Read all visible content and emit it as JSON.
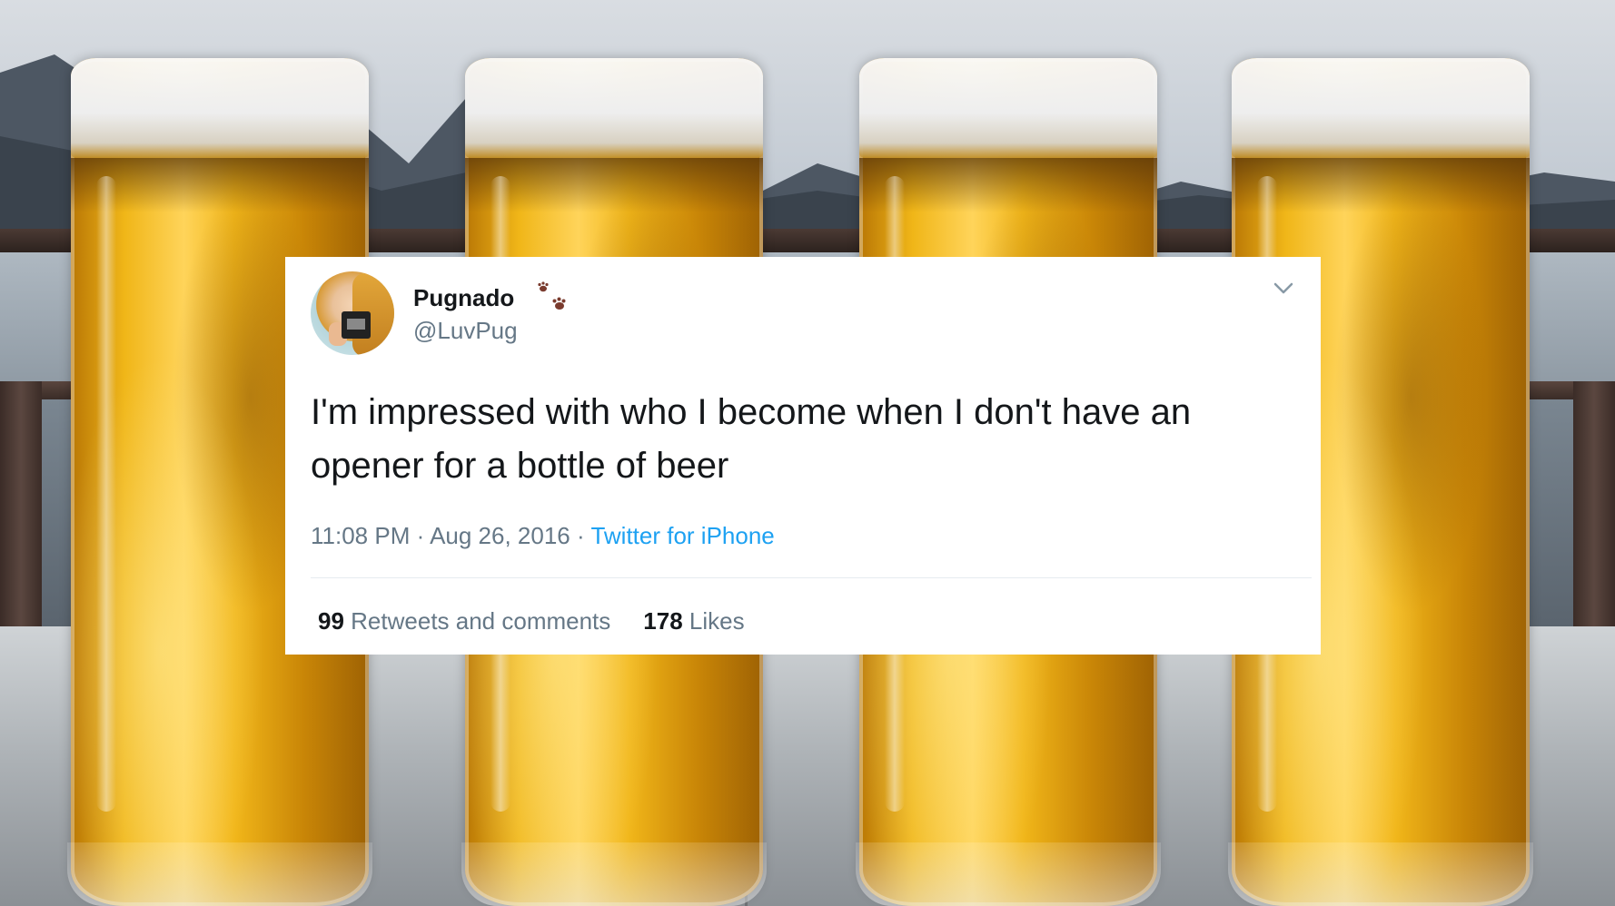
{
  "tweet": {
    "display_name": "Pugnado",
    "badge_icon": "paw-prints-icon",
    "handle": "@LuvPug",
    "text": "I'm impressed with who I become when I don't have an opener for a bottle of beer",
    "time": "11:08 PM",
    "date": "Aug 26, 2016",
    "separator": "·",
    "source": "Twitter for iPhone",
    "retweets_count": "99",
    "retweets_label": "Retweets and comments",
    "likes_count": "178",
    "likes_label": "Likes",
    "menu_icon": "chevron-down-icon",
    "colors": {
      "name": "#14171a",
      "secondary": "#657786",
      "link": "#1da1f2",
      "paw": "#7a3b2e"
    }
  }
}
